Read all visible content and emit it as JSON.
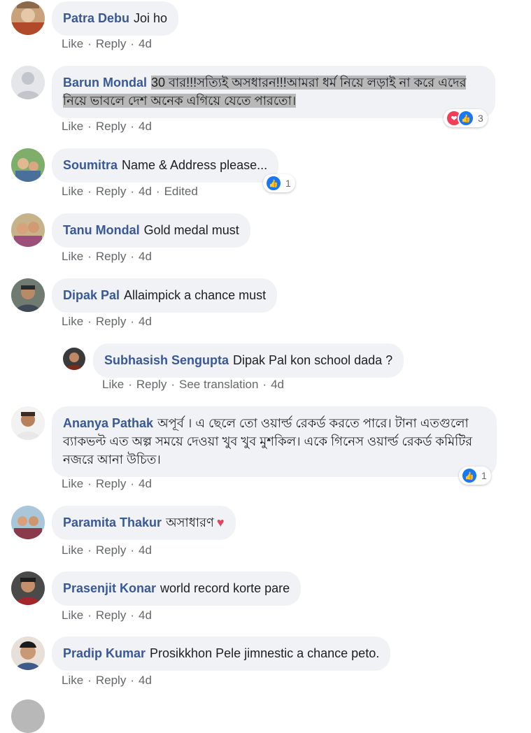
{
  "actions": {
    "like": "Like",
    "reply": "Reply",
    "see_translation": "See translation",
    "edited": "Edited"
  },
  "comments": [
    {
      "name": "Patra Debu",
      "text": "Joi ho",
      "time": "4d"
    },
    {
      "name": "Barun Mondal",
      "text": "30 বার!!!সত্যিই অসধারন!!!আমরা ধর্ম নিয়ে লড়াই না করে এদের নিয়ে ভাবলে দেশ অনেক এগিয়ে যেতে পারতো।",
      "time": "4d",
      "reactions": {
        "icons": [
          "love-icon",
          "like-icon"
        ],
        "count": "3"
      }
    },
    {
      "name": "Soumitra",
      "text": "Name & Address please...",
      "time": "4d",
      "reactions": {
        "icons": [
          "like-icon"
        ],
        "count": "1"
      }
    },
    {
      "name": "Tanu Mondal",
      "text": "Gold medal must",
      "time": "4d"
    },
    {
      "name": "Dipak Pal",
      "text": "Allaimpick a chance must",
      "time": "4d"
    },
    {
      "name": "Subhasish Sengupta",
      "text": "Dipak Pal kon school dada ?",
      "time": "4d"
    },
    {
      "name": "Ananya Pathak",
      "text": "অপূর্ব । এ ছেলে তো ওয়ার্ল্ড রেকর্ড করতে পারে। টানা এতগুলো ব্যাকভল্ট এত অল্প সময়ে দেওয়া খুব খুব মুশকিল। একে গিনেস ওয়ার্ল্ড রেকর্ড কমিটির নজরে আনা উচিত।",
      "time": "4d",
      "reactions": {
        "icons": [
          "like-icon"
        ],
        "count": "1"
      }
    },
    {
      "name": "Paramita Thakur",
      "text": "অসাধারণ",
      "time": "4d",
      "emoji": "heart-icon"
    },
    {
      "name": "Prasenjit Konar",
      "text": "world record korte pare",
      "time": "4d"
    },
    {
      "name": "Pradip Kumar",
      "text": "Prosikkhon Pele jimnestic a chance peto.",
      "time": "4d"
    }
  ],
  "colors": {
    "name": "#385898",
    "meta": "#65676b",
    "bubble": "#f0f2f5",
    "like": "#1877f2",
    "love": "#f33e58"
  }
}
